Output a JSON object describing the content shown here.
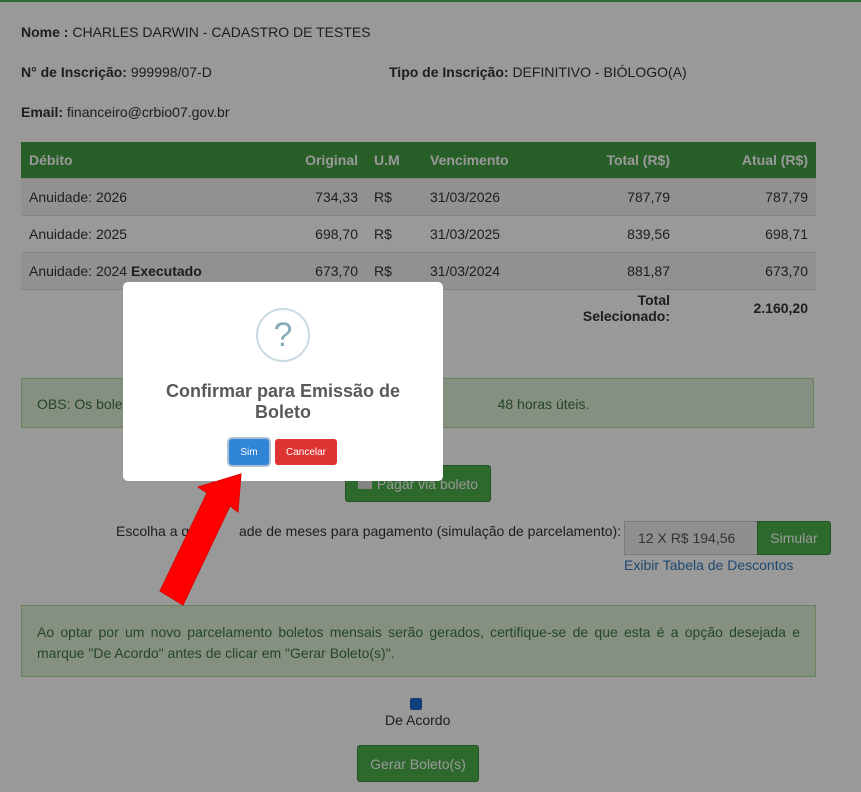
{
  "profile": {
    "name_label": "Nome :",
    "name_value": "CHARLES DARWIN - CADASTRO DE TESTES",
    "registration_label": "N° de Inscrição:",
    "registration_value": "999998/07-D",
    "type_label": "Tipo de Inscrição:",
    "type_value": "DEFINITIVO - BIÓLOGO(A)",
    "email_label": "Email:",
    "email_value": "financeiro@crbio07.gov.br"
  },
  "table": {
    "headers": [
      "Débito",
      "Original",
      "U.M",
      "Vencimento",
      "Total (R$)",
      "Atual (R$)"
    ],
    "rows": [
      {
        "debit": "Anuidade: 2026",
        "status": "",
        "original": "734,33",
        "um": "R$",
        "due": "31/03/2026",
        "total": "787,79",
        "current": "787,79"
      },
      {
        "debit": "Anuidade: 2025",
        "status": "",
        "original": "698,70",
        "um": "R$",
        "due": "31/03/2025",
        "total": "839,56",
        "current": "698,71"
      },
      {
        "debit": "Anuidade: 2024",
        "status": "Executado",
        "original": "673,70",
        "um": "R$",
        "due": "31/03/2024",
        "total": "881,87",
        "current": "673,70"
      }
    ],
    "total_label": "Total Selecionado:",
    "total_value": "2.160,20"
  },
  "obs": {
    "prefix": "OBS: Os bole",
    "suffix": "48 horas úteis."
  },
  "pay_button": "Pagar via boleto",
  "simulation": {
    "label_part1": "Escolha a qu",
    "label_part2": "ade de meses para pagamento (simulação de parcelamento):",
    "input_value": "12 X R$ 194,56",
    "button": "Simular",
    "discount_link": "Exibir Tabela de Descontos"
  },
  "installment_alert": "Ao optar por um novo parcelamento boletos mensais serão gerados, certifique-se de que esta é a opção desejada e marque \"De Acordo\" antes de clicar em \"Gerar Boleto(s)\".",
  "agree_label": "De Acordo",
  "generate_button": "Gerar Boleto(s)",
  "modal": {
    "icon": "question-icon",
    "icon_glyph": "?",
    "title": "Confirmar para Emissão de Boleto",
    "confirm_button": "Sim",
    "cancel_button": "Cancelar"
  },
  "colors": {
    "header_green": "#449d44",
    "confirm_blue": "#3085d6",
    "cancel_red": "#dd3333",
    "arrow_red": "#ff0000"
  }
}
